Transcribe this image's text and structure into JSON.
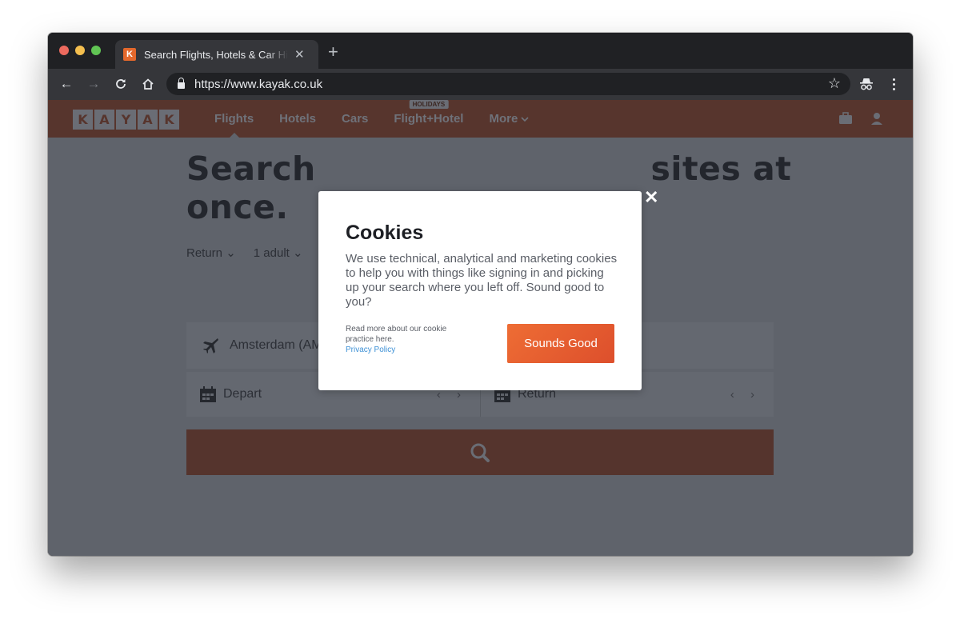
{
  "browser": {
    "tab_title": "Search Flights, Hotels & Car Hire",
    "tab_favicon": "K",
    "url": "https://www.kayak.co.uk",
    "icons": [
      "back-icon",
      "forward-icon",
      "reload-icon",
      "home-icon",
      "lock-icon",
      "star-icon",
      "incognito-icon",
      "menu-icon"
    ]
  },
  "header": {
    "logo_letters": [
      "K",
      "A",
      "Y",
      "A",
      "K"
    ],
    "nav": [
      {
        "label": "Flights",
        "active": true
      },
      {
        "label": "Hotels"
      },
      {
        "label": "Cars"
      },
      {
        "label": "Flight+Hotel",
        "badge": "HOLIDAYS"
      },
      {
        "label": "More"
      }
    ],
    "more_chevron": "⌄"
  },
  "search": {
    "headline": "Search hundreds of travel sites at once.",
    "headline_visible_left": "Search",
    "headline_visible_right": "sites at",
    "headline_line2": "once.",
    "trip_type": "Return",
    "travellers": "1 adult",
    "origin": "Amsterdam (AMS)",
    "origin_visible": "Amsterdam (AM",
    "depart_placeholder": "Depart",
    "return_placeholder": "Return"
  },
  "cookie_modal": {
    "title": "Cookies",
    "body": "We use technical, analytical and marketing cookies to help you with things like signing in and picking up your search where you left off. Sound good to you?",
    "footnote": "Read more about our cookie practice here.",
    "privacy_link": "Privacy Policy",
    "accept_label": "Sounds Good",
    "close_glyph": "✕"
  },
  "colors": {
    "brand_orange": "#ee6d34",
    "link_blue": "#3e91d6",
    "overlay_gray": "#5f636b"
  }
}
